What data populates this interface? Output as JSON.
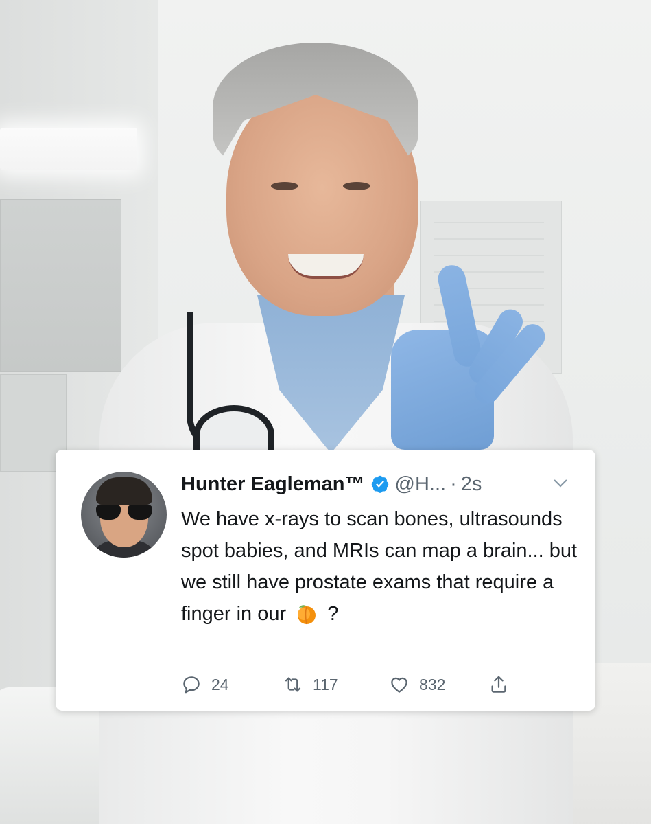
{
  "tweet": {
    "author_name": "Hunter Eagleman™",
    "handle": "@H...",
    "separator": "·",
    "time": "2s",
    "text_before_emoji": "We have x-rays to scan bones, ultrasounds spot babies, and MRIs can map a brain... but we still have prostate exams that require a finger in our",
    "emoji": "peach-emoji",
    "text_after_emoji": "?",
    "reply_count": "24",
    "retweet_count": "117",
    "like_count": "832"
  },
  "colors": {
    "verified": "#1d9bf0",
    "text_primary": "#14171a",
    "text_secondary": "#5b6670",
    "card_background": "#ffffff",
    "glove": "#7aa7dc"
  },
  "icons": [
    "verified-badge-icon",
    "chevron-down-icon",
    "reply-icon",
    "retweet-icon",
    "like-icon",
    "share-icon",
    "peach-emoji-icon"
  ]
}
